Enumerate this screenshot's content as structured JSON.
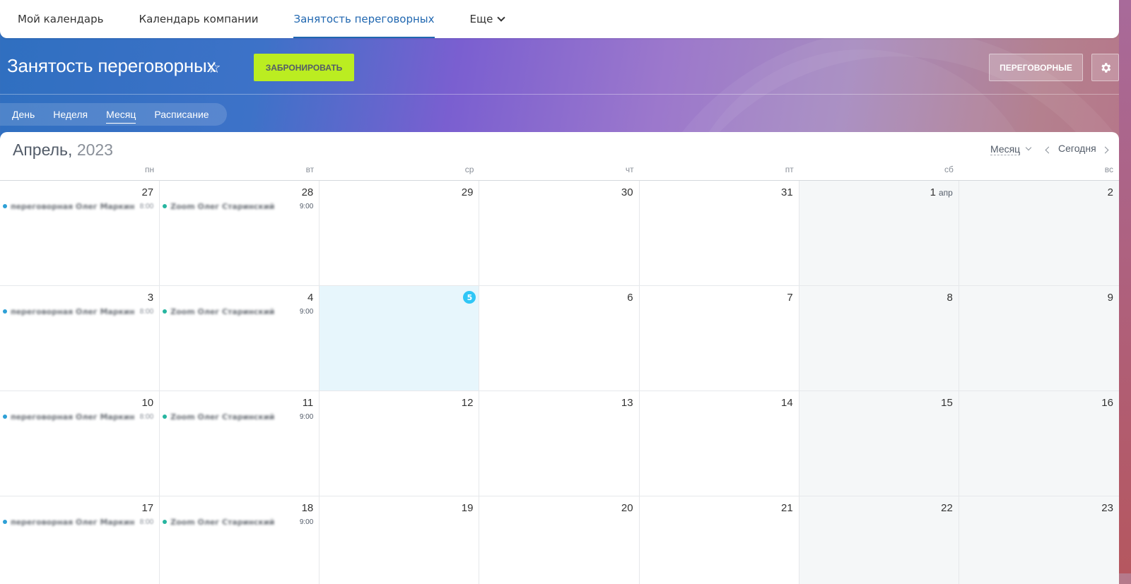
{
  "nav": {
    "items": [
      "Мой календарь",
      "Календарь компании",
      "Занятость переговорных",
      "Еще"
    ],
    "active": 2
  },
  "header": {
    "title": "Занятость переговорных",
    "book_button": "ЗАБРОНИРОВАТЬ",
    "rooms_button": "ПЕРЕГОВОРНЫЕ",
    "book_button_color": "#bbed21"
  },
  "view_tabs": {
    "items": [
      "День",
      "Неделя",
      "Месяц",
      "Расписание"
    ],
    "active": 2
  },
  "calendar": {
    "month_name": "Апрель,",
    "year": "2023",
    "mode_label": "Месяц",
    "today_label": "Сегодня",
    "weekdays": [
      "пн",
      "вт",
      "ср",
      "чт",
      "пт",
      "сб",
      "вс"
    ],
    "weeks": [
      [
        "27",
        "28",
        "29",
        "30",
        "31",
        "1",
        "2"
      ],
      [
        "3",
        "4",
        "5",
        "6",
        "7",
        "8",
        "9"
      ],
      [
        "10",
        "11",
        "12",
        "13",
        "14",
        "15",
        "16"
      ],
      [
        "17",
        "18",
        "19",
        "20",
        "21",
        "22",
        "23"
      ]
    ],
    "month_start_label": "апр",
    "today_day": "5",
    "events": {
      "monday": {
        "title": "переговорная Олег Маркин",
        "time": "8:00",
        "color": "#2ea0d6"
      },
      "tuesday": {
        "title": "Zoom Олег Старинский",
        "time": "9:00",
        "color": "#27b5a0"
      }
    }
  }
}
